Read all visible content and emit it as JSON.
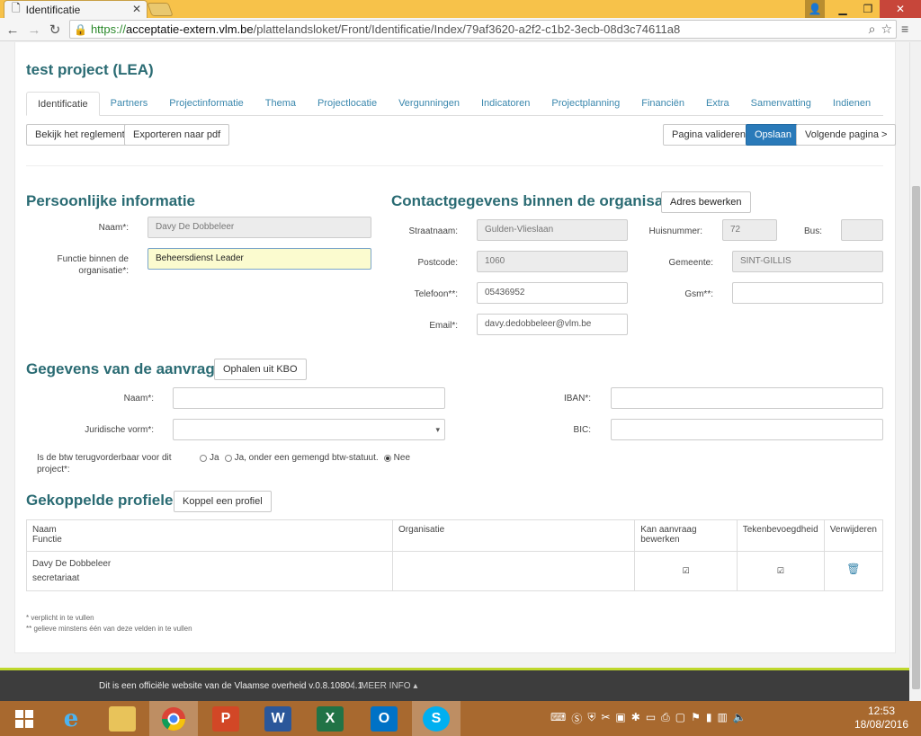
{
  "browser": {
    "tab_title": "Identificatie",
    "url_scheme": "https://",
    "url_host": "acceptatie-extern.vlm.be",
    "url_path": "/plattelandsloket/Front/Identificatie/Index/79af3620-a2f2-c1b2-3ecb-08d3c74611a8"
  },
  "page": {
    "project_title": "test project (LEA)",
    "tabs": [
      {
        "label": "Identificatie",
        "active": true
      },
      {
        "label": "Partners"
      },
      {
        "label": "Projectinformatie"
      },
      {
        "label": "Thema"
      },
      {
        "label": "Projectlocatie"
      },
      {
        "label": "Vergunningen"
      },
      {
        "label": "Indicatoren"
      },
      {
        "label": "Projectplanning"
      },
      {
        "label": "Financiën"
      },
      {
        "label": "Extra"
      },
      {
        "label": "Samenvatting"
      },
      {
        "label": "Indienen"
      }
    ],
    "actions": {
      "reglement": "Bekijk het reglement",
      "export_pdf": "Exporteren naar pdf",
      "validate": "Pagina valideren",
      "save": "Opslaan",
      "next": "Volgende pagina >"
    }
  },
  "persoonlijk": {
    "title": "Persoonlijke informatie",
    "naam_label": "Naam*:",
    "naam_value": "Davy De Dobbeleer",
    "functie_label": "Functie binnen de organisatie*:",
    "functie_value": "Beheersdienst Leader"
  },
  "contact": {
    "title": "Contactgegevens binnen de organisatie",
    "edit_button": "Adres bewerken",
    "straat_label": "Straatnaam:",
    "straat_value": "Gulden-Vlieslaan",
    "huisnummer_label": "Huisnummer:",
    "huisnummer_value": "72",
    "bus_label": "Bus:",
    "bus_value": "",
    "postcode_label": "Postcode:",
    "postcode_value": "1060",
    "gemeente_label": "Gemeente:",
    "gemeente_value": "SINT-GILLIS",
    "telefoon_label": "Telefoon**:",
    "telefoon_value": "05436952",
    "gsm_label": "Gsm**:",
    "gsm_value": "",
    "email_label": "Email*:",
    "email_value": "davy.dedobbeleer@vlm.be"
  },
  "aanvrager": {
    "title": "Gegevens van de aanvrager",
    "kbo_button": "Ophalen uit KBO",
    "naam_label": "Naam*:",
    "naam_value": "",
    "iban_label": "IBAN*:",
    "iban_value": "",
    "juridische_label": "Juridische vorm*:",
    "juridische_value": "",
    "bic_label": "BIC:",
    "bic_value": "",
    "btw_label": "Is de btw terugvorderbaar voor dit project*:",
    "btw_options": [
      "Ja",
      "Ja, onder een gemengd btw-statuut.",
      "Nee"
    ],
    "btw_selected": "Nee"
  },
  "profielen": {
    "title": "Gekoppelde profielen",
    "add_button": "Koppel een profiel",
    "headers": {
      "naam": "Naam",
      "functie": "Functie",
      "organisatie": "Organisatie",
      "kan_bewerken": "Kan aanvraag bewerken",
      "tekenbevoegdheid": "Tekenbevoegdheid",
      "verwijderen": "Verwijderen"
    },
    "rows": [
      {
        "naam": "Davy De Dobbeleer",
        "functie": "secretariaat",
        "organisatie": "",
        "kan_bewerken": true,
        "tekenbevoegd": true
      }
    ]
  },
  "footnotes": {
    "required": "* verplicht in te vullen",
    "one_of": "** gelieve minstens één van deze velden in te vullen"
  },
  "site_footer": {
    "text": "Dit is een officiële website van de Vlaamse overheid v.0.8.10804.1",
    "more": "MEER INFO"
  },
  "taskbar": {
    "time": "12:53",
    "date": "18/08/2016",
    "apps": [
      "start",
      "internet-explorer",
      "file-explorer",
      "chrome",
      "powerpoint",
      "word",
      "excel",
      "outlook",
      "skype"
    ]
  },
  "colors": {
    "accent_title": "#2a6b73",
    "primary_button": "#2a7ab9",
    "link": "#3a87ad",
    "footer_stripe": "#bfd82d",
    "taskbar": "#a8692f"
  }
}
